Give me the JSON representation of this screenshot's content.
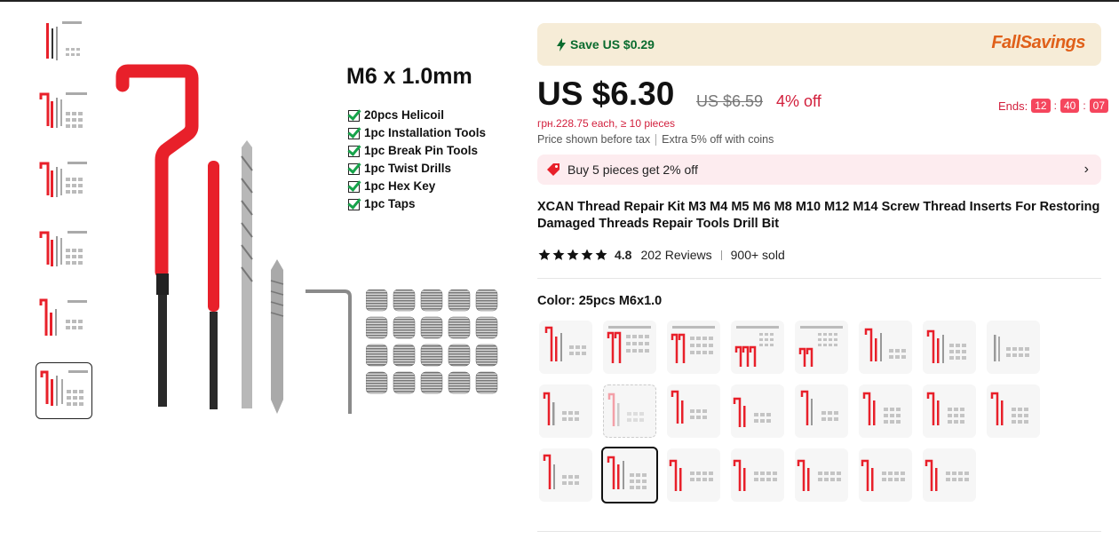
{
  "thumbnails": {
    "count": 6,
    "active_index": 5,
    "icon": "product-thumbnail"
  },
  "main_image": {
    "title": "M6 x 1.0mm",
    "items": [
      "20pcs Helicoil",
      "1pc Installation Tools",
      "1pc Break Pin Tools",
      "1pc Twist Drills",
      "1pc Hex Key",
      "1pc Taps"
    ]
  },
  "savings": {
    "text": "Save US $0.29",
    "icon": "lightning-icon",
    "logo": "FallSavings"
  },
  "price": {
    "current": "US $6.30",
    "original": "US $6.59",
    "discount": "4% off",
    "ends_label": "Ends:",
    "timer": [
      "12",
      "40",
      "07"
    ],
    "each": "грн.228.75 each, ≥ 10 pieces",
    "tax_note": "Price shown before tax",
    "coins_note": "Extra 5% off with coins"
  },
  "promo": {
    "text": "Buy 5 pieces get 2% off",
    "icon": "tag-icon"
  },
  "product": {
    "title": "XCAN Thread Repair Kit M3 M4 M5 M6 M8 M10 M12 M14 Screw Thread Inserts For Restoring Damaged Threads Repair Tools Drill Bit"
  },
  "rating": {
    "score": "4.8",
    "reviews": "202 Reviews",
    "sold": "900+ sold",
    "stars": 5
  },
  "color": {
    "label": "Color: 25pcs M6x1.0",
    "swatch_count": 23,
    "selected_index": 17
  },
  "colors": {
    "accent_red": "#d21f3c",
    "save_green": "#0a6b2e",
    "savebar_bg": "#f6ecd7",
    "promo_bg": "#fdecef",
    "tool_red": "#e8202a"
  }
}
